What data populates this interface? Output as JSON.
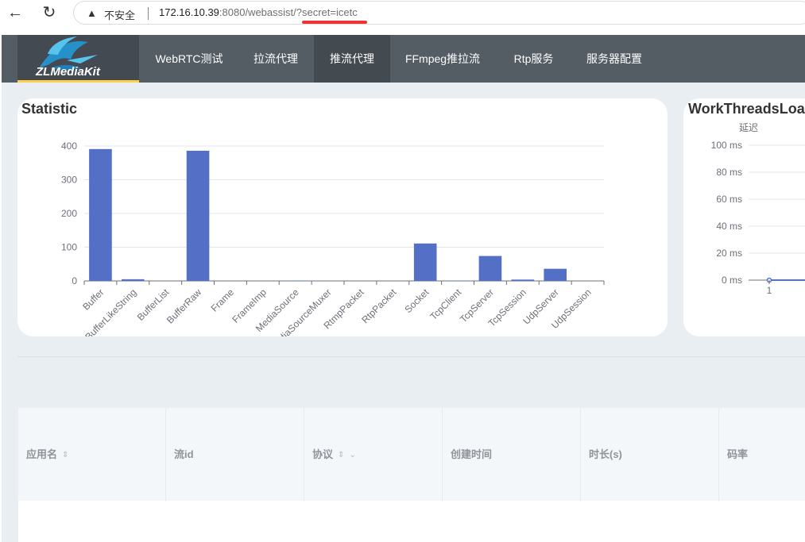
{
  "browser": {
    "back_icon": "back-arrow-icon",
    "reload_icon": "reload-icon",
    "warning_icon": "warning-icon",
    "insecure_label": "不安全",
    "url_host": "172.16.10.39",
    "url_rest": ":8080/webassist/",
    "url_query": "?secret=icetc"
  },
  "nav": {
    "logo_text": "ZLMediaKit",
    "items": [
      "WebRTC测试",
      "拉流代理",
      "推流代理",
      "FFmpeg推拉流",
      "Rtp服务",
      "服务器配置"
    ],
    "active": "推流代理",
    "active_color": "#434a50",
    "underline_color": "#ffd04b"
  },
  "statistic": {
    "title": "Statistic",
    "chart_data": {
      "type": "bar",
      "categories": [
        "Buffer",
        "BufferLikeString",
        "BufferList",
        "BufferRaw",
        "Frame",
        "FrameImp",
        "MediaSource",
        "MediaSourceMuxer",
        "RtmpPacket",
        "RtpPacket",
        "Socket",
        "TcpClient",
        "TcpServer",
        "TcpSession",
        "UdpServer",
        "UdpSession"
      ],
      "values": [
        391,
        5,
        0,
        386,
        0,
        0,
        1,
        0,
        0,
        0,
        111,
        1,
        74,
        4,
        36,
        0
      ],
      "yticks": [
        "0",
        "100",
        "200",
        "300",
        "400"
      ],
      "ylim": [
        0,
        400
      ],
      "color": "#5470c6"
    }
  },
  "workthreads": {
    "title": "WorkThreadsLoad",
    "chart_data": {
      "type": "line",
      "legend": "延迟",
      "x": [
        "1"
      ],
      "values": [
        0
      ],
      "yticks": [
        "0 ms",
        "20 ms",
        "40 ms",
        "60 ms",
        "80 ms",
        "100 ms"
      ],
      "ylim": [
        0,
        100
      ],
      "color": "#5470c6"
    }
  },
  "table": {
    "columns": [
      "应用名",
      "流id",
      "协议",
      "创建时间",
      "时长(s)",
      "码率"
    ]
  }
}
